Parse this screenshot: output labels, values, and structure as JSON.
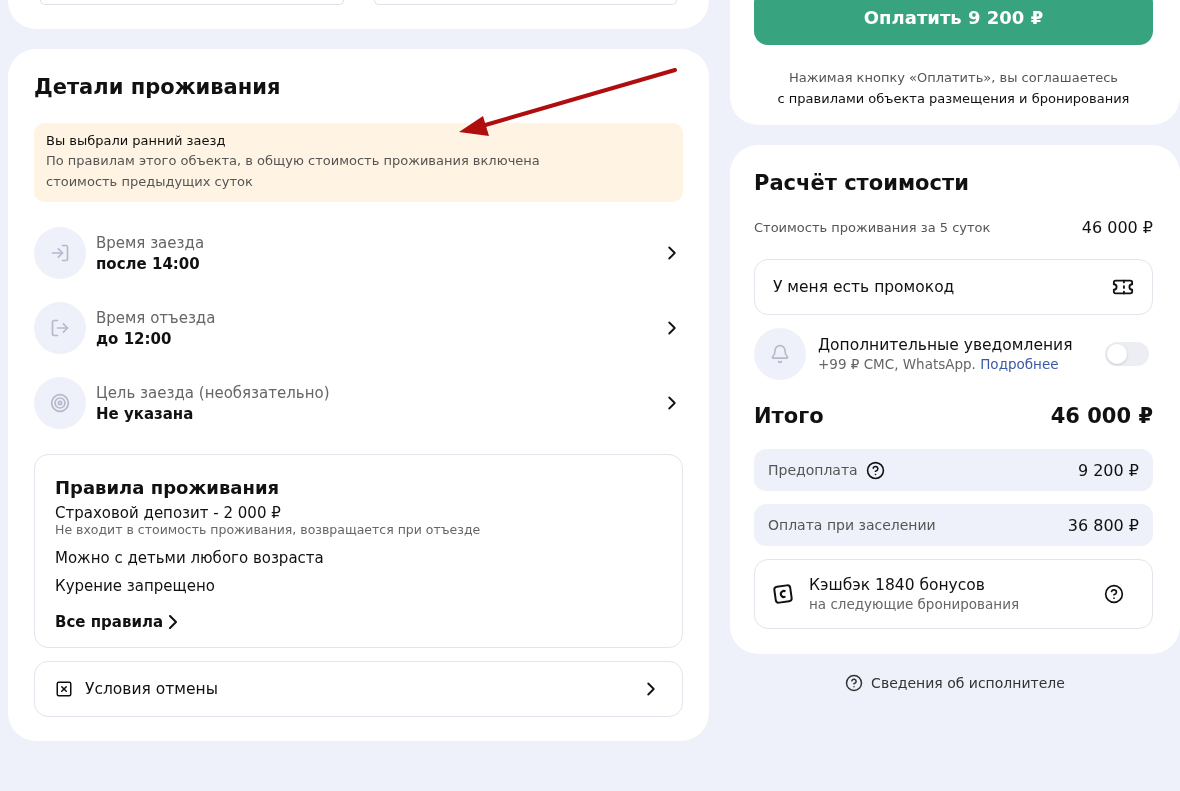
{
  "details": {
    "title": "Детали проживания",
    "notice": {
      "title": "Вы выбрали ранний заезд",
      "text": "По правилам этого объекта, в общую стоимость проживания включена стоимость предыдущих суток"
    },
    "items": [
      {
        "kind": "checkin",
        "label": "Время заезда",
        "value": "после 14:00"
      },
      {
        "kind": "checkout",
        "label": "Время отъезда",
        "value": "до 12:00"
      },
      {
        "kind": "purpose",
        "label": "Цель заезда (необязательно)",
        "value": "Не указана"
      }
    ],
    "rules": {
      "title": "Правила проживания",
      "deposit": "Страховой депозит - 2 000 ₽",
      "deposit_note": "Не входит в стоимость проживания, возвращается при отъезде",
      "lines": [
        "Можно с детьми любого возраста",
        "Курение запрещено"
      ],
      "link": "Все правила"
    },
    "cancellation": "Условия отмены"
  },
  "payment": {
    "button": "Оплатить 9 200 ₽",
    "consent": "Нажимая кнопку «Оплатить», вы соглашаетесь",
    "consent_link": "с правилами объекта размещения и бронирования"
  },
  "calculation": {
    "title": "Расчёт стоимости",
    "stay_label": "Стоимость проживания за 5 суток",
    "stay_value": "46 000 ₽",
    "promo": "У меня есть промокод",
    "notifications": {
      "title": "Дополнительные уведомления",
      "text": "+99 ₽ СМС, WhatsApp.",
      "link": "Подробнее",
      "on": false
    },
    "total_label": "Итого",
    "total_value": "46 000 ₽",
    "parts": [
      {
        "label": "Предоплата",
        "value": "9 200 ₽",
        "help": true
      },
      {
        "label": "Оплата при заселении",
        "value": "36 800 ₽",
        "help": false
      }
    ],
    "cashback": {
      "title": "Кэшбэк 1840 бонусов",
      "text": "на следующие бронирования"
    }
  },
  "contractor_link": "Сведения об исполнителе"
}
